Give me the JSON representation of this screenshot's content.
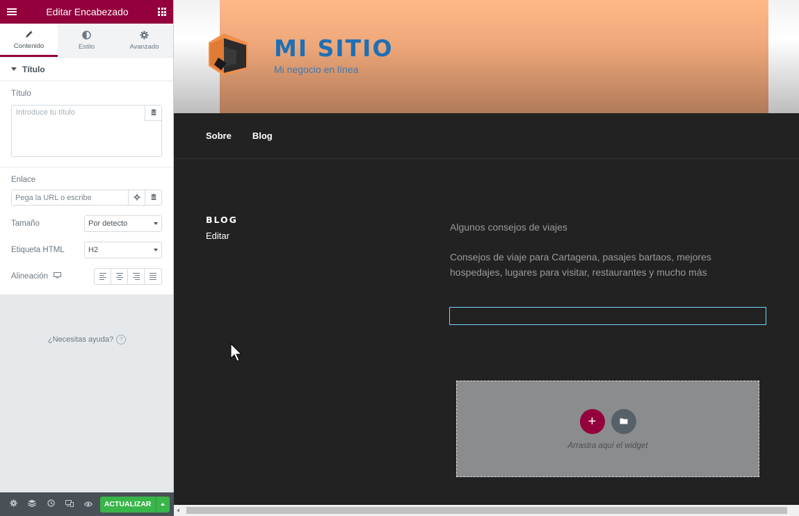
{
  "panel": {
    "header_title": "Editar Encabezado",
    "tabs": [
      {
        "label": "Contenido",
        "icon": "pencil-icon",
        "active": true
      },
      {
        "label": "Estilo",
        "icon": "contrast-icon",
        "active": false
      },
      {
        "label": "Avanzado",
        "icon": "gear-icon",
        "active": false
      }
    ],
    "section_title": "Título",
    "title_control": {
      "label": "Título",
      "placeholder": "Introduce tu título",
      "value": ""
    },
    "link_control": {
      "label": "Enlace",
      "placeholder": "Pega la URL o escribe"
    },
    "size_control": {
      "label": "Tamaño",
      "value": "Por detecto"
    },
    "html_tag_control": {
      "label": "Etiqueta HTML",
      "value": "H2"
    },
    "alignment_control": {
      "label": "Alineación"
    },
    "help_text": "¿Necesitas ayuda?",
    "footer": {
      "update_label": "ACTUALIZAR"
    }
  },
  "site": {
    "title": "MI SITIO",
    "description": "Mi negocio en línea",
    "nav": [
      "Sobre",
      "Blog"
    ]
  },
  "content": {
    "blog_heading": "BLOG",
    "edit_link": "Editar",
    "post_title": "Algunos consejos de viajes",
    "post_excerpt": "Consejos de viaje para Cartagena, pasajes bartaos, mejores hospedajes, lugares para visitar, restaurantes y mucho más",
    "dropzone_text": "Arrastra aquí el widget"
  },
  "colors": {
    "brand": "#93003c",
    "update_green": "#39b54a",
    "site_title_blue": "#1f6fb5",
    "selected_outline": "#71d7f7"
  }
}
